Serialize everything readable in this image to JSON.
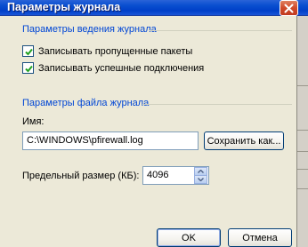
{
  "window": {
    "title": "Параметры журнала",
    "close_icon": "close-x-icon"
  },
  "logging": {
    "section_title": "Параметры ведения журнала",
    "options": [
      {
        "label": "Записывать пропущенные пакеты",
        "checked": true
      },
      {
        "label": "Записывать успешные подключения",
        "checked": true
      }
    ]
  },
  "logfile": {
    "section_title": "Параметры файла журнала",
    "name_label": "Имя:",
    "path_value": "C:\\WINDOWS\\pfirewall.log",
    "save_as_label": "Сохранить как...",
    "size_label": "Предельный размер (КБ):",
    "size_value": "4096"
  },
  "footer": {
    "ok_label": "OK",
    "cancel_label": "Отмена"
  },
  "colors": {
    "section_title": "#0046d5",
    "titlebar": "#0a4fd0",
    "close_button": "#d04a2a"
  }
}
